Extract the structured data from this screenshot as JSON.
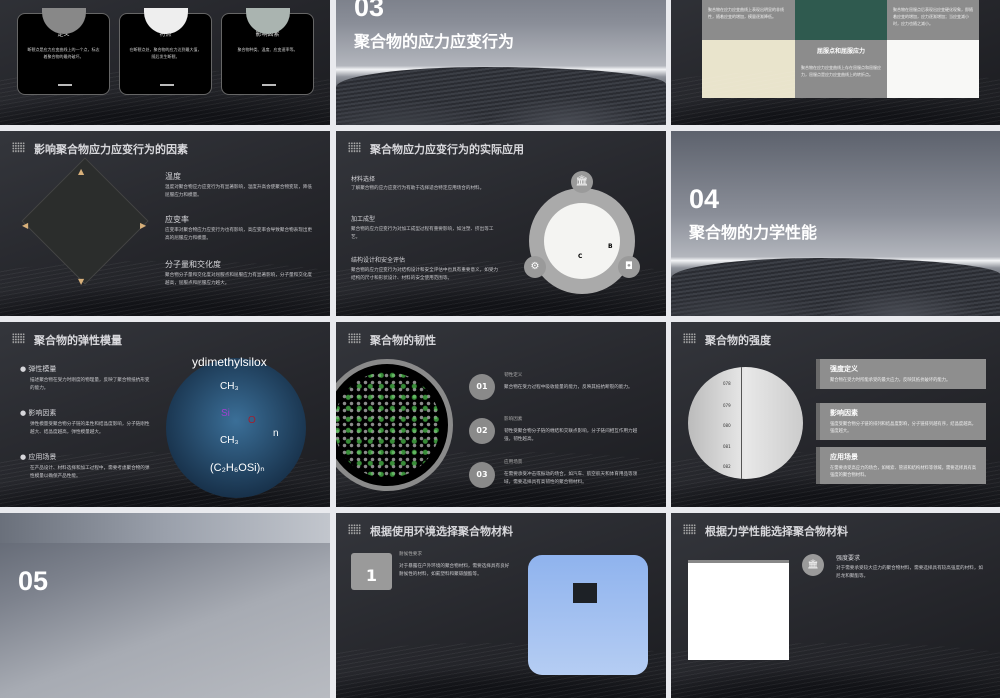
{
  "slides": {
    "s1": {
      "cards": [
        {
          "title": "定义",
          "text": "断裂点是应力应变曲线上的一个点，标志着聚合物的最终破坏。"
        },
        {
          "title": "特点",
          "text": "在断裂点处，聚合物的应力达到最大值，随后发生断裂。"
        },
        {
          "title": "影响因素",
          "text": "聚合物种类、温度、应变速率等。"
        }
      ]
    },
    "s2": {
      "number": "03",
      "title": "聚合物的应力应变行为"
    },
    "s3": {
      "text1": "聚合物在应力应变曲线上表现出明显的非线性，随着应变的增加，模量逐渐降低。",
      "text2": "聚合物在屈服点后表现出应变硬化现象，即随着应变的增加，应力逐渐增加；当应变减小时，应力也随之减小。",
      "heading": "屈服点和屈服应力",
      "text3": "聚合物在应力应变曲线上存在屈服点和屈服应力，屈服点是应力应变曲线上的转折点。"
    },
    "s4": {
      "title": "影响聚合物应力应变行为的因素",
      "items": [
        {
          "h": "温度",
          "p": "温度对聚合物应力应变行为有显著影响，温度升高会使聚合物变软，降低屈服应力和模量。"
        },
        {
          "h": "应变率",
          "p": "应变率对聚合物应力应变行为也有影响，高应变率会导致聚合物表现出更高的屈服应力和模量。"
        },
        {
          "h": "分子量和交化度",
          "p": "聚合物分子量和交化度对屈服点和屈服应力有显著影响，分子量和交化度越高，屈服点和屈服应力越大。"
        }
      ]
    },
    "s5": {
      "title": "聚合物应力应变行为的实际应用",
      "items": [
        {
          "h": "材料选择",
          "p": "了解聚合物的应力应变行为有助于选择适合特定应用场合的材料。"
        },
        {
          "h": "加工成型",
          "p": "聚合物的应力应变行为对加工成型过程有重要影响，如注塑、挤出等工艺。"
        },
        {
          "h": "结构设计和安全评估",
          "p": "聚合物的应力应变行为对结构设计和安全评估中也具有重要意义，如受力结构的尺寸和形状设计、材料的安全使用范围等。"
        }
      ],
      "image_labels": [
        "C",
        "B"
      ]
    },
    "s6": {
      "number": "04",
      "title": "聚合物的力学性能"
    },
    "s7": {
      "title": "聚合物的弹性模量",
      "items": [
        {
          "h": "弹性模量",
          "p": "描述聚合物在受力时刚度的物理量，反映了聚合物抵抗形变的能力。"
        },
        {
          "h": "影响因素",
          "p": "弹性模量受聚合物分子链的柔性和结晶度影响，分子链刚性越大、结晶度越高，弹性模量越大。"
        },
        {
          "h": "应用场景",
          "p": "在产品设计、材料选择和加工过程中，需要考虑聚合物的弹性模量以确保产品性能。"
        }
      ],
      "molecule": {
        "name": "ydimethylsilox",
        "top": "CH₃",
        "center": "Si",
        "o": "O",
        "bottom": "CH₃",
        "n": "n",
        "formula": "(C₂H₆OSi)ₙ"
      }
    },
    "s8": {
      "title": "聚合物的韧性",
      "items": [
        {
          "n": "01",
          "h": "韧性定义",
          "p": "聚合物在受力过程中吸收能量的能力，反映其抵抗断裂的能力。"
        },
        {
          "n": "02",
          "h": "影响因素",
          "p": "韧性受聚合物分子链的缠结和交联点影响，分子链间相互作用力越强，韧性越高。"
        },
        {
          "n": "03",
          "h": "应用场景",
          "p": "在需要承受冲击或振动的场合，如汽车、航空航天和体育用品等领域，需要选择具有高韧性的聚合物材料。"
        }
      ]
    },
    "s9": {
      "title": "聚合物的强度",
      "items": [
        {
          "h": "强度定义",
          "p": "聚合物在受力时所能承受的最大应力，反映其抵抗破坏的能力。"
        },
        {
          "h": "影响因素",
          "p": "强度受聚合物分子链的排列和结晶度影响，分子链排列越有序，结晶度越高，强度越大。"
        },
        {
          "h": "应用场景",
          "p": "在需要承受高应力的场合，如绳索、管道和结构材料等领域，需要选择具有高强度的聚合物材料。"
        }
      ],
      "scale_labels": [
        "078",
        "079",
        "080",
        "081",
        "082"
      ]
    },
    "s10": {
      "number": "05"
    },
    "s11": {
      "title": "根据使用环境选择聚合物材料",
      "item": {
        "n": "1",
        "h": "耐候性要求",
        "p": "对于暴露在户外环境的聚合物材料，需要选择具有良好耐候性的材料，如氟塑料和聚碳酸酯等。"
      }
    },
    "s12": {
      "title": "根据力学性能选择聚合物材料",
      "item": {
        "h": "强度要求",
        "p": "对于需要承受较大应力的聚合物材料，需要选择具有较高强度的材料，如尼龙和聚酯等。"
      }
    }
  }
}
